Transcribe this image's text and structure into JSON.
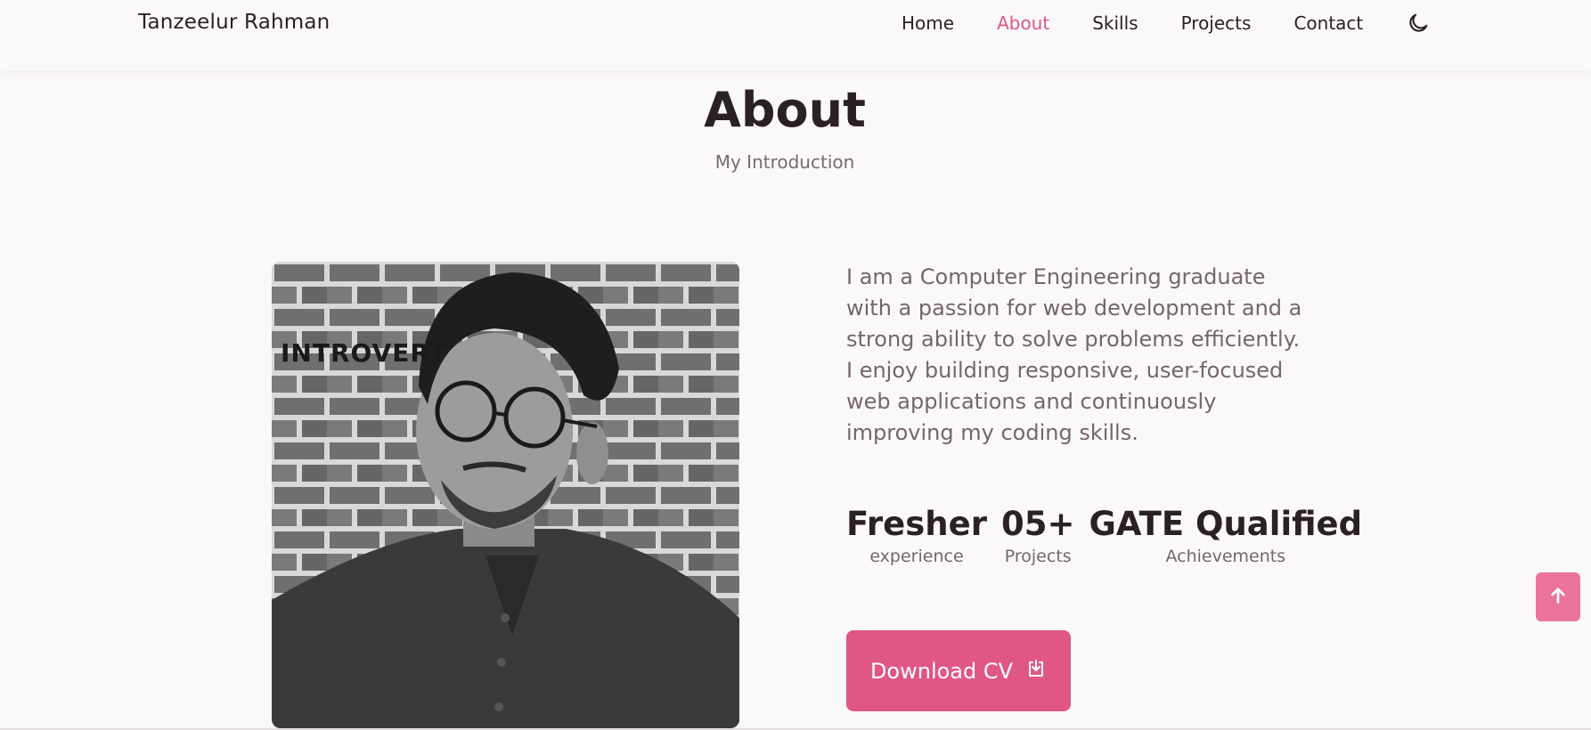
{
  "nav": {
    "logo": "Tanzeelur Rahman",
    "links": [
      {
        "label": "Home",
        "active": false
      },
      {
        "label": "About",
        "active": true
      },
      {
        "label": "Skills",
        "active": false
      },
      {
        "label": "Projects",
        "active": false
      },
      {
        "label": "Contact",
        "active": false
      }
    ],
    "theme_icon": "moon-icon"
  },
  "about": {
    "title": "About",
    "subtitle": "My Introduction",
    "photo_caption": "INTROVERT",
    "description": "I am a Computer Engineering graduate with a passion for web development and a strong ability to solve problems efficiently. I enjoy building responsive, user-focused web applications and continuously improving my coding skills.",
    "stats": [
      {
        "value": "Fresher",
        "label": "experience"
      },
      {
        "value": "05+",
        "label": "Projects"
      },
      {
        "value": "GATE Qualified",
        "label": "Achievements"
      }
    ],
    "download_label": "Download CV",
    "download_icon": "download-icon"
  },
  "scroll_top_icon": "arrow-up-icon",
  "colors": {
    "accent": "#df5687",
    "accent_light": "#e9739d",
    "background": "#fbf8f9",
    "text": "#2b2124",
    "muted_text": "#74666b"
  }
}
